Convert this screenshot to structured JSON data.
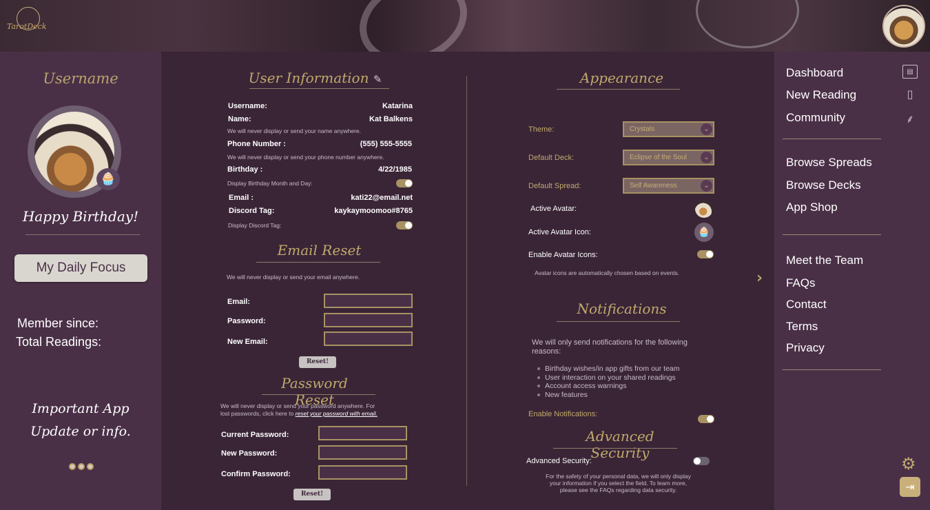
{
  "header": {
    "logo_text": "TarotDeck"
  },
  "left": {
    "title": "Username",
    "birthday_text": "Happy Birthday!",
    "focus_button": "My Daily Focus",
    "member_since": "Member since:",
    "total_readings": "Total Readings:",
    "important_line1": "Important App",
    "important_line2": "Update or info."
  },
  "user_info": {
    "heading": "User Information",
    "username_label": "Username:",
    "username": "Katarina",
    "name_label": "Name:",
    "name": "Kat Balkens",
    "name_note": "We will never display or send your name anywhere.",
    "phone_label": "Phone Number :",
    "phone": "(555) 555-5555",
    "phone_note": "We will never display or send your phone number anywhere.",
    "birthday_label": "Birthday :",
    "birthday": "4/22/1985",
    "birthday_display": "Display Birthday Month and Day:",
    "email_label": "Email :",
    "email": "kati22@email.net",
    "discord_label": "Discord Tag:",
    "discord": "kaykaymoomoo#8765",
    "discord_display": "Display Discord Tag:"
  },
  "email_reset": {
    "heading": "Email Reset",
    "note": "We will never display or send your email anywhere.",
    "email_label": "Email:",
    "password_label": "Password:",
    "new_email_label": "New Email:",
    "button": "Reset!"
  },
  "password_reset": {
    "heading": "Password Reset",
    "note_line1": "We will never display or send your password anywhere. For",
    "note_line2": "lost passwords, click here to",
    "note_link": "reset your password with email.",
    "current_label": "Current Password:",
    "new_label": "New Password:",
    "confirm_label": "Confirm Password:",
    "button": "Reset!"
  },
  "appearance": {
    "heading": "Appearance",
    "theme_label": "Theme:",
    "theme_value": "Crystals",
    "deck_label": "Default Deck:",
    "deck_value": "Eclipse of the Soul",
    "spread_label": "Default Spread:",
    "spread_value": "Self Awareness",
    "avatar_label": "Active Avatar:",
    "avatar_icon_label": "Active Avatar Icon:",
    "enable_icons_label": "Enable Avatar Icons:",
    "icons_note": "Avatar icons are automatically chosen based on events."
  },
  "notifications": {
    "heading": "Notifications",
    "intro_line1": "We will only send notifications for the following",
    "intro_line2": "reasons:",
    "reasons": [
      "Birthday wishes/in app gifts from our team",
      "User interaction on your shared readings",
      "Account access warnings",
      "New features"
    ],
    "enable_label": "Enable Notifications:"
  },
  "security": {
    "heading": "Advanced Security",
    "label": "Advanced Security:",
    "note_line1": "For the safety of your personal data, we will only display",
    "note_line2": "your information if you select the field. To learn more,",
    "note_line3": "please see the FAQs regarding data security."
  },
  "nav": {
    "dashboard": "Dashboard",
    "new_reading": "New Reading",
    "community": "Community",
    "browse_spreads": "Browse Spreads",
    "browse_decks": "Browse Decks",
    "app_shop": "App Shop",
    "meet_team": "Meet the Team",
    "faqs": "FAQs",
    "contact": "Contact",
    "terms": "Terms",
    "privacy": "Privacy"
  },
  "colors": {
    "accent": "#c1a96c",
    "panel": "#4a3047",
    "background": "#3a2537"
  }
}
